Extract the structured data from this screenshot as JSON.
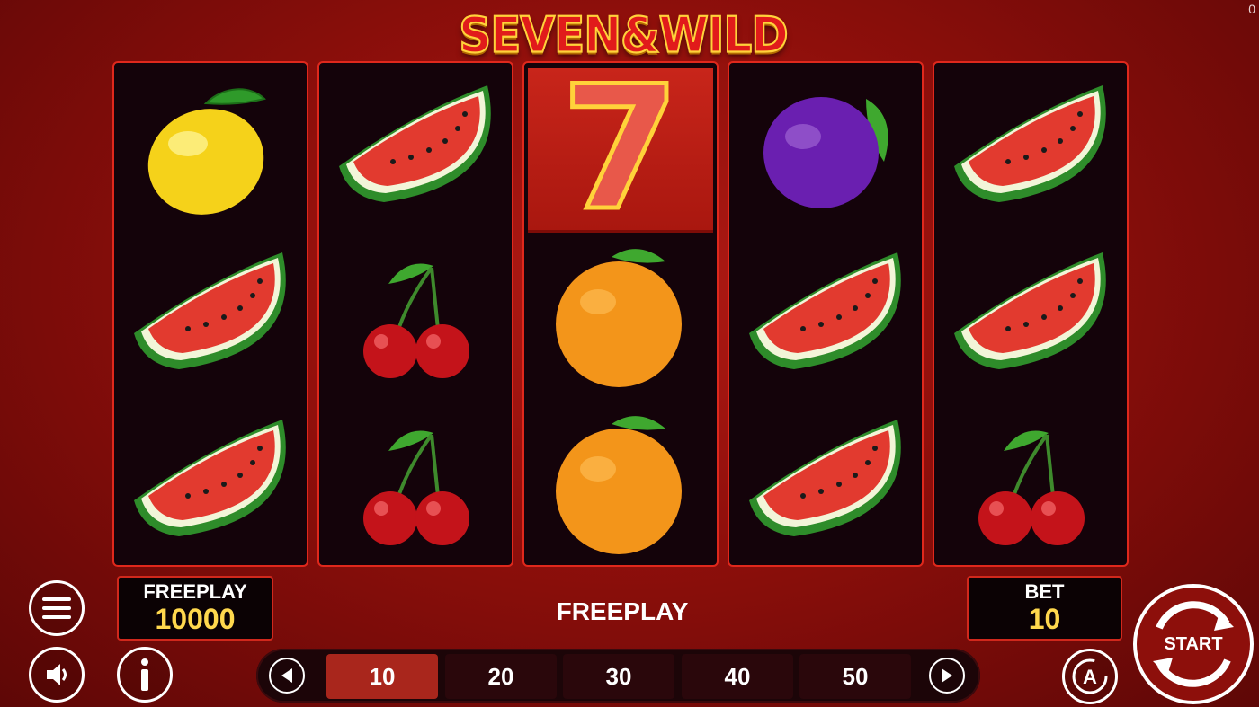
{
  "corner_counter": "0",
  "logo": {
    "text": "SEVEN&WILD"
  },
  "reels": [
    [
      "lemon",
      "watermelon",
      "watermelon"
    ],
    [
      "watermelon",
      "cherries",
      "cherries"
    ],
    [
      "seven",
      "orange",
      "orange"
    ],
    [
      "plum",
      "watermelon",
      "watermelon"
    ],
    [
      "watermelon",
      "watermelon",
      "cherries"
    ]
  ],
  "seven_symbol_text": "7",
  "freeplay_panel": {
    "label": "FREEPLAY",
    "value": "10000"
  },
  "status_text": "FREEPLAY",
  "bet_panel": {
    "label": "BET",
    "value": "10"
  },
  "bet_options": [
    "10",
    "20",
    "30",
    "40",
    "50"
  ],
  "selected_bet": "10",
  "autoplay_label": "A",
  "start_label": "START",
  "icons": {
    "menu": "hamburger-menu-icon",
    "sound": "speaker-icon",
    "info": "info-icon",
    "prev": "chevron-left-icon",
    "next": "chevron-right-icon",
    "autoplay": "autoplay-icon",
    "start": "refresh-arrows-icon"
  },
  "colors": {
    "accent": "#e0281c",
    "value": "#ffd84d",
    "active_bet": "#a9261c"
  }
}
